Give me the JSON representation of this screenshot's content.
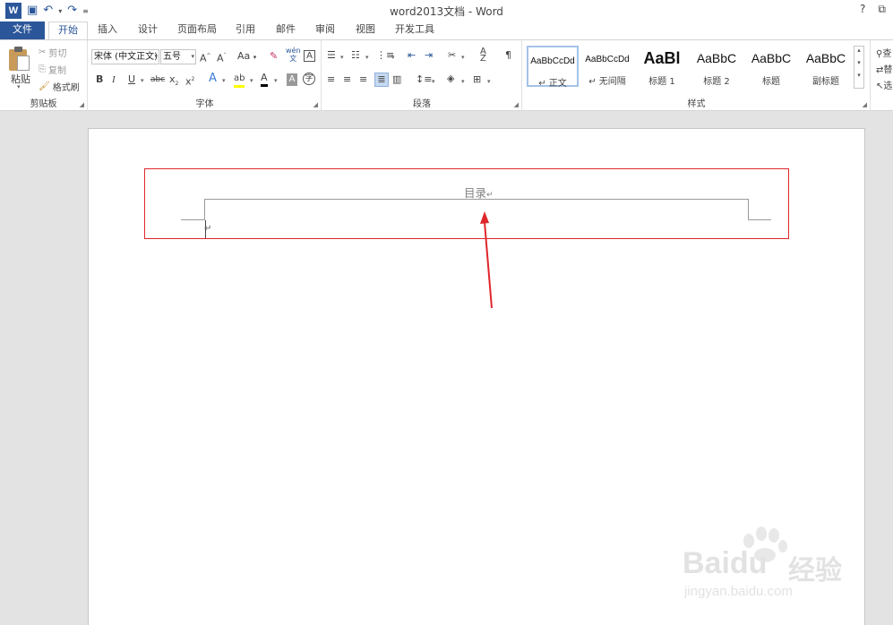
{
  "titlebar": {
    "app_logo": "W",
    "title": "word2013文档 - Word",
    "help": "?",
    "restore": "⧉"
  },
  "tabs": [
    {
      "label": "文件"
    },
    {
      "label": "开始"
    },
    {
      "label": "插入"
    },
    {
      "label": "设计"
    },
    {
      "label": "页面布局"
    },
    {
      "label": "引用"
    },
    {
      "label": "邮件"
    },
    {
      "label": "审阅"
    },
    {
      "label": "视图"
    },
    {
      "label": "开发工具"
    }
  ],
  "clipboard": {
    "paste": "粘贴",
    "cut": "剪切",
    "copy": "复制",
    "format_painter": "格式刷",
    "label": "剪贴板"
  },
  "font": {
    "font_name": "宋体 (中文正文)",
    "font_size": "五号",
    "label": "字体",
    "case_label": "Aa",
    "phonetic_top": "wén",
    "phonetic_bottom": "文"
  },
  "paragraph": {
    "label": "段落"
  },
  "styles": {
    "label": "样式",
    "items": [
      {
        "sample": "AaBbCcDd",
        "name": "↵ 正文"
      },
      {
        "sample": "AaBbCcDd",
        "name": "↵ 无间隔"
      },
      {
        "sample": "AaBl",
        "name": "标题 1"
      },
      {
        "sample": "AaBbC",
        "name": "标题 2"
      },
      {
        "sample": "AaBbC",
        "name": "标题"
      },
      {
        "sample": "AaBbC",
        "name": "副标题"
      }
    ]
  },
  "editing": {
    "find": "查",
    "replace": "替",
    "select": "选"
  },
  "document": {
    "toc_heading": "目录",
    "para_mark": "↵"
  },
  "watermark": {
    "brand": "Baidu",
    "brand_cn": "经验",
    "url": "jingyan.baidu.com"
  },
  "colors": {
    "accent": "#2b579a",
    "highlight_box": "#e0262b",
    "arrow": "#e0262b"
  }
}
